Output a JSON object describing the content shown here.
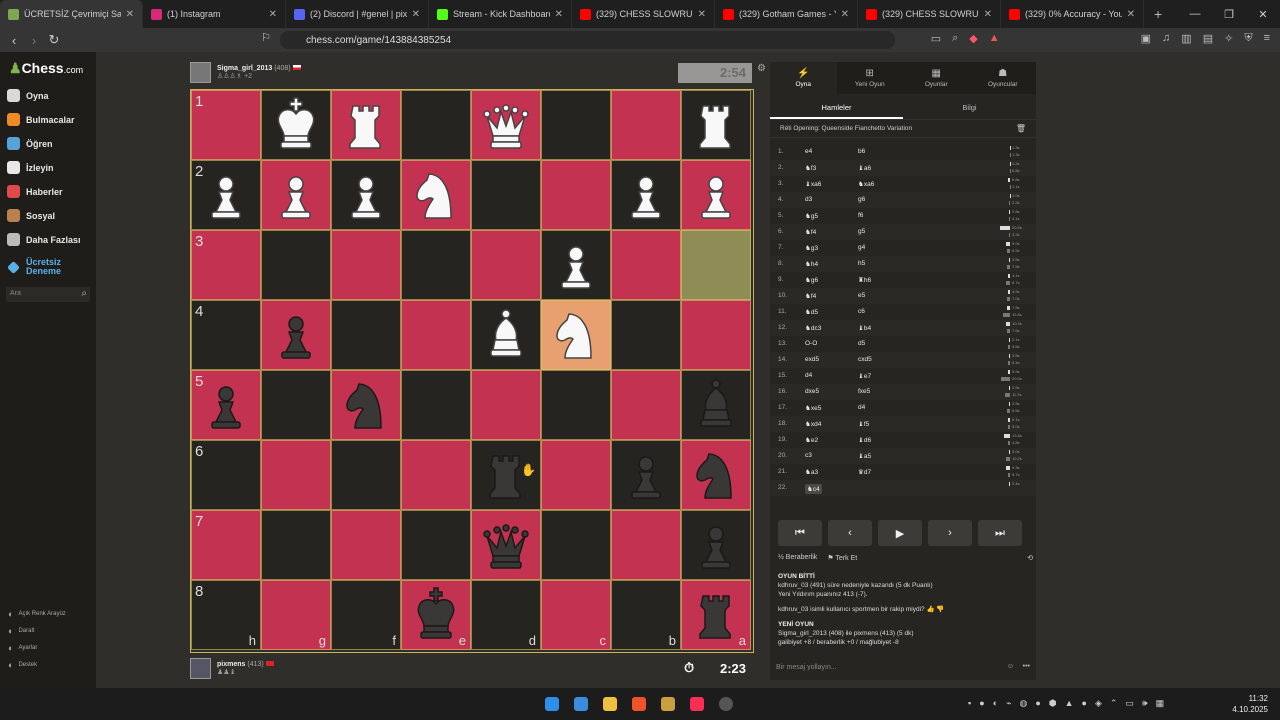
{
  "browser": {
    "tabs": [
      {
        "title": "ÜCRETSİZ Çevrimiçi Satranç",
        "color": "#7fa650",
        "active": true
      },
      {
        "title": "(1) Instagram",
        "color": "#d6297b"
      },
      {
        "title": "(2) Discord | #genel | pixme",
        "color": "#5865f2"
      },
      {
        "title": "Stream - Kick Dashboard",
        "color": "#53fc18"
      },
      {
        "title": "(329) CHESS SLOWRUN EPISOD",
        "color": "#ff0000"
      },
      {
        "title": "(329) Gotham Games - YouTube",
        "color": "#ff0000"
      },
      {
        "title": "(329) CHESS SLOWRUN (Bonus",
        "color": "#ff0000"
      },
      {
        "title": "(329) 0% Accuracy - YouTube",
        "color": "#ff0000"
      }
    ],
    "url": "chess.com/game/143884385254"
  },
  "sidebar": {
    "logo": "Chess",
    "logo_suffix": ".com",
    "items": [
      {
        "label": "Oyna",
        "color": "#d9d9d9"
      },
      {
        "label": "Bulmacalar",
        "color": "#f08a24"
      },
      {
        "label": "Öğren",
        "color": "#55a3d8"
      },
      {
        "label": "İzleyin",
        "color": "#e8e8e8"
      },
      {
        "label": "Haberler",
        "color": "#e04a4a"
      },
      {
        "label": "Sosyal",
        "color": "#b9814b"
      },
      {
        "label": "Daha Fazlası",
        "color": "#bbbbbb"
      }
    ],
    "free_trial": "Ücretsiz Deneme",
    "search_placeholder": "Ara",
    "bottom": [
      "Açık Renk Arayüz",
      "Daralt",
      "Ayarlar",
      "Destek"
    ]
  },
  "top_player": {
    "name": "Sigma_girl_2013",
    "rating": "(408)",
    "captured": "+2",
    "clock": "2:54"
  },
  "bottom_player": {
    "name": "pixmens",
    "rating": "(413)",
    "clock": "2:23"
  },
  "board": {
    "ranks": [
      "1",
      "2",
      "3",
      "4",
      "5",
      "6",
      "7",
      "8"
    ],
    "files": [
      "h",
      "g",
      "f",
      "e",
      "d",
      "c",
      "b",
      "a"
    ],
    "pieces": [
      {
        "sq": [
          0,
          1
        ],
        "p": "K",
        "c": "w"
      },
      {
        "sq": [
          0,
          2
        ],
        "p": "R",
        "c": "w"
      },
      {
        "sq": [
          0,
          4
        ],
        "p": "Q",
        "c": "w"
      },
      {
        "sq": [
          0,
          7
        ],
        "p": "R",
        "c": "w"
      },
      {
        "sq": [
          1,
          0
        ],
        "p": "P",
        "c": "w"
      },
      {
        "sq": [
          1,
          1
        ],
        "p": "P",
        "c": "w"
      },
      {
        "sq": [
          1,
          2
        ],
        "p": "P",
        "c": "w"
      },
      {
        "sq": [
          1,
          3
        ],
        "p": "N",
        "c": "w"
      },
      {
        "sq": [
          1,
          6
        ],
        "p": "P",
        "c": "w"
      },
      {
        "sq": [
          1,
          7
        ],
        "p": "P",
        "c": "w"
      },
      {
        "sq": [
          2,
          5
        ],
        "p": "P",
        "c": "w"
      },
      {
        "sq": [
          3,
          1
        ],
        "p": "P",
        "c": "b"
      },
      {
        "sq": [
          3,
          4
        ],
        "p": "B",
        "c": "w"
      },
      {
        "sq": [
          3,
          5
        ],
        "p": "N",
        "c": "w"
      },
      {
        "sq": [
          4,
          0
        ],
        "p": "P",
        "c": "b"
      },
      {
        "sq": [
          4,
          2
        ],
        "p": "N",
        "c": "b"
      },
      {
        "sq": [
          4,
          7
        ],
        "p": "B",
        "c": "b"
      },
      {
        "sq": [
          5,
          4
        ],
        "p": "R",
        "c": "b"
      },
      {
        "sq": [
          5,
          6
        ],
        "p": "P",
        "c": "b"
      },
      {
        "sq": [
          5,
          7
        ],
        "p": "N",
        "c": "b"
      },
      {
        "sq": [
          6,
          4
        ],
        "p": "Q",
        "c": "b"
      },
      {
        "sq": [
          6,
          7
        ],
        "p": "P",
        "c": "b"
      },
      {
        "sq": [
          7,
          3
        ],
        "p": "K",
        "c": "b"
      },
      {
        "sq": [
          7,
          7
        ],
        "p": "R",
        "c": "b"
      }
    ],
    "highlight_from": [
      2,
      7
    ],
    "highlight_to": [
      3,
      5
    ]
  },
  "panel": {
    "tabs": [
      "Oyna",
      "Yeni Oyun",
      "Oyunlar",
      "Oyuncular"
    ],
    "subtabs": [
      "Hamleler",
      "Bilgi"
    ],
    "opening": "Réti Opening: Queenside Fianchetto Variation",
    "moves": [
      {
        "n": "1.",
        "w": "e4",
        "b": "b6",
        "t1": "1.3s",
        "t2": "1.3s",
        "f1": 0.05,
        "f2": 0.05
      },
      {
        "n": "2.",
        "w": "♞f3",
        "b": "♝a6",
        "t1": "1.2s",
        "t2": "0.8s",
        "f1": 0.05,
        "f2": 0.03
      },
      {
        "n": "3.",
        "w": "♝xa6",
        "b": "♞xa6",
        "t1": "6.8s",
        "t2": "1.1s",
        "f1": 0.2,
        "f2": 0.05
      },
      {
        "n": "4.",
        "w": "d3",
        "b": "g6",
        "t1": "1.0s",
        "t2": "2.2s",
        "f1": 0.04,
        "f2": 0.08
      },
      {
        "n": "5.",
        "w": "♞g5",
        "b": "f6",
        "t1": "2.8s",
        "t2": "4.1s",
        "f1": 0.1,
        "f2": 0.14
      },
      {
        "n": "6.",
        "w": "♞f4",
        "b": "g5",
        "t1": "20.5s",
        "t2": "3.2s",
        "f1": 1.0,
        "f2": 0.12
      },
      {
        "n": "7.",
        "w": "♞g3",
        "b": "g4",
        "t1": "9.0s",
        "t2": "6.5s",
        "f1": 0.4,
        "f2": 0.28
      },
      {
        "n": "8.",
        "w": "♞h4",
        "b": "h5",
        "t1": "3.5s",
        "t2": "7.9s",
        "f1": 0.15,
        "f2": 0.35
      },
      {
        "n": "9.",
        "w": "♞g6",
        "b": "♜h6",
        "t1": "4.1s",
        "t2": "8.7s",
        "f1": 0.18,
        "f2": 0.4
      },
      {
        "n": "10.",
        "w": "♞f4",
        "b": "e5",
        "t1": "4.9s",
        "t2": "7.0s",
        "f1": 0.22,
        "f2": 0.3
      },
      {
        "n": "11.",
        "w": "♞d5",
        "b": "c6",
        "t1": "7.5s",
        "t2": "15.8s",
        "f1": 0.33,
        "f2": 0.75
      },
      {
        "n": "12.",
        "w": "♞dc3",
        "b": "♝b4",
        "t1": "10.4s",
        "t2": "7.6s",
        "f1": 0.45,
        "f2": 0.33
      },
      {
        "n": "13.",
        "w": "O-O",
        "b": "d5",
        "t1": "2.1s",
        "t2": "5.6s",
        "f1": 0.08,
        "f2": 0.25
      },
      {
        "n": "14.",
        "w": "exd5",
        "b": "cxd5",
        "t1": "3.5s",
        "t2": "5.4s",
        "f1": 0.15,
        "f2": 0.23
      },
      {
        "n": "15.",
        "w": "d4",
        "b": "♝e7",
        "t1": "5.9s",
        "t2": "20.0s",
        "f1": 0.25,
        "f2": 0.9
      },
      {
        "n": "16.",
        "w": "dxe5",
        "b": "fxe5",
        "t1": "2.9s",
        "t2": "11.2s",
        "f1": 0.12,
        "f2": 0.5
      },
      {
        "n": "17.",
        "w": "♞xe5",
        "b": "d4",
        "t1": "2.5s",
        "t2": "6.6s",
        "f1": 0.1,
        "f2": 0.3
      },
      {
        "n": "18.",
        "w": "♞xd4",
        "b": "♝f5",
        "t1": "5.1s",
        "t2": "5.0s",
        "f1": 0.22,
        "f2": 0.22
      },
      {
        "n": "19.",
        "w": "♞e2",
        "b": "♝d6",
        "t1": "13.8s",
        "t2": "4.8s",
        "f1": 0.6,
        "f2": 0.2
      },
      {
        "n": "20.",
        "w": "c3",
        "b": "♝a5",
        "t1": "3.0s",
        "t2": "10.2s",
        "f1": 0.12,
        "f2": 0.45
      },
      {
        "n": "21.",
        "w": "♞a3",
        "b": "♛d7",
        "t1": "9.3s",
        "t2": "5.7s",
        "f1": 0.4,
        "f2": 0.25
      },
      {
        "n": "22.",
        "w": "♞c4",
        "b": "",
        "t1": "2.4s",
        "t2": "",
        "f1": 0.1,
        "f2": 0
      }
    ],
    "actions": [
      "Beraberlik",
      "Terk Et"
    ],
    "chat": {
      "over_title": "OYUN BİTTİ",
      "over_text": "kdhruv_03 (491) süre nedeniyle kazandı (5 dk Puanlı)",
      "rating_text": "Yeni Yıldırım puanınız 413 (-7).",
      "sportsman": "kdhruv_03 isimli kullanıcı sportmen bir rakip miydi?",
      "new_title": "YENİ OYUN",
      "new_text": "Sigma_girl_2013 (408) ile pixmens (413) (5 dk)",
      "record": "galibiyet +8 / beraberlik +0 / mağlubiyet -8"
    },
    "chat_placeholder": "Bir mesaj yollayın..."
  },
  "taskbar": {
    "time": "11:32",
    "date": "4.10.2025"
  }
}
